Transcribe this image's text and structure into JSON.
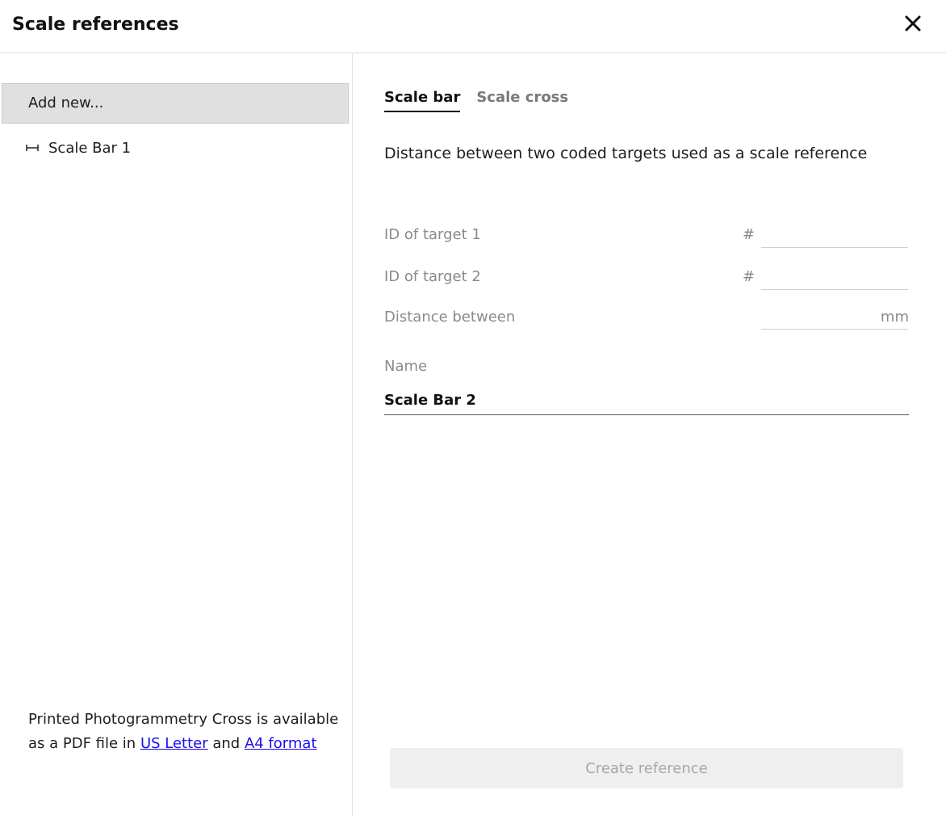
{
  "header": {
    "title": "Scale references",
    "close_icon": "close-icon"
  },
  "sidebar": {
    "add_new_label": "Add new...",
    "items": [
      {
        "label": "Scale Bar 1",
        "icon": "scale-bar-icon"
      }
    ],
    "footer": {
      "text_before": "Printed Photogrammetry Cross is available as a PDF file in ",
      "link_us_letter": "US Letter",
      "text_middle": " and ",
      "link_a4": "A4 format"
    }
  },
  "main": {
    "tabs": [
      {
        "label": "Scale bar",
        "active": true
      },
      {
        "label": "Scale cross",
        "active": false
      }
    ],
    "description": "Distance between two coded targets used as a scale reference",
    "fields": {
      "target1": {
        "label": "ID of target 1",
        "prefix": "#",
        "value": ""
      },
      "target2": {
        "label": "ID of target 2",
        "prefix": "#",
        "value": ""
      },
      "distance": {
        "label": "Distance between",
        "suffix": "mm",
        "value": ""
      }
    },
    "name": {
      "label": "Name",
      "value": "Scale Bar 2"
    },
    "create_button_label": "Create reference"
  },
  "colors": {
    "link": "#1a0dee",
    "add_new_bg": "#e0e0e0",
    "disabled_button_bg": "#efefef",
    "disabled_text": "#a8a8a8"
  }
}
